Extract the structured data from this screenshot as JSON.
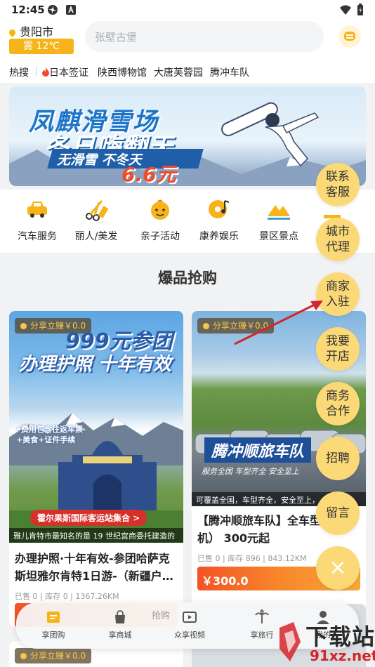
{
  "status_bar": {
    "time": "12:45"
  },
  "header": {
    "city": "贵阳市",
    "weather_text": "雾 12℃",
    "search_placeholder": "张壁古堡"
  },
  "hot_search": {
    "label": "热搜",
    "items": [
      "日本签证",
      "陕西博物馆",
      "大唐芙蓉园",
      "腾冲车队"
    ]
  },
  "banner": {
    "line1": "凤麒滑雪场",
    "line2": "冬日嗨翻天",
    "line3": "无滑雪 不冬天",
    "price": "6.6元"
  },
  "categories": [
    {
      "label": "汽车服务",
      "icon": "car-icon",
      "color": "#f7b41a"
    },
    {
      "label": "丽人/美发",
      "icon": "scissors-comb-icon",
      "color": "#f7b41a"
    },
    {
      "label": "亲子活动",
      "icon": "child-face-icon",
      "color": "#f7b41a"
    },
    {
      "label": "康养娱乐",
      "icon": "music-disc-icon",
      "color": "#f7b41a"
    },
    {
      "label": "景区景点",
      "icon": "mountain-icon",
      "color": "#f7b41a"
    }
  ],
  "section_title": "爆品抢购",
  "products": [
    {
      "badge": "分享立赚￥0.0",
      "img_line1": "999元参团",
      "img_line2": "办理护照 十年有效",
      "img_bullet1": "•费用包含往返车票",
      "img_bullet2": "+美食+证件手续",
      "img_ribbon": "霍尔果斯国际客运站集合 >",
      "img_caption": "雅儿肯特市最知名的是 19 世纪宫商委托建造的",
      "title": "办理护照·十年有效-参团哈萨克斯坦雅尔肯特1日游-（新疆户…",
      "stats": "已售 0 | 库存 0 | 1367.26KM",
      "price": ""
    },
    {
      "badge": "分享立赚￥0.0",
      "img_line1": "腾冲顺旅车队",
      "img_line2": "服务全国  车型齐全  安全至上",
      "img_caption": "可覆盖全国，车型齐全，安全至上，",
      "title": "【腾冲顺旅车队】全车型（带司机） 300元起",
      "stats": "已售 0 | 库存 896 | 843.12KM",
      "price": "￥300.0"
    }
  ],
  "side_buttons": [
    "联系客服",
    "城市代理",
    "商家入驻",
    "我要开店",
    "商务合作",
    "招聘",
    "留言"
  ],
  "close_label": "×",
  "bottom_nav": [
    {
      "label": "享团购",
      "icon": "coupon-icon"
    },
    {
      "label": "享商城",
      "icon": "shopping-bag-icon"
    },
    {
      "label": "众享视频",
      "icon": "video-icon"
    },
    {
      "label": "享旅行",
      "icon": "palm-tree-icon"
    },
    {
      "label": "我的",
      "icon": "user-icon"
    }
  ],
  "bottom_overlay_text": "抢购",
  "watermark": {
    "text1": "下载站",
    "text2": "91xz.net"
  },
  "colors": {
    "accent": "#f7b41a",
    "side_button": "#fbd977",
    "price_gradient_start": "#f35327",
    "price_gradient_end": "#f7a83a",
    "hot_fire": "#f04b2a"
  }
}
